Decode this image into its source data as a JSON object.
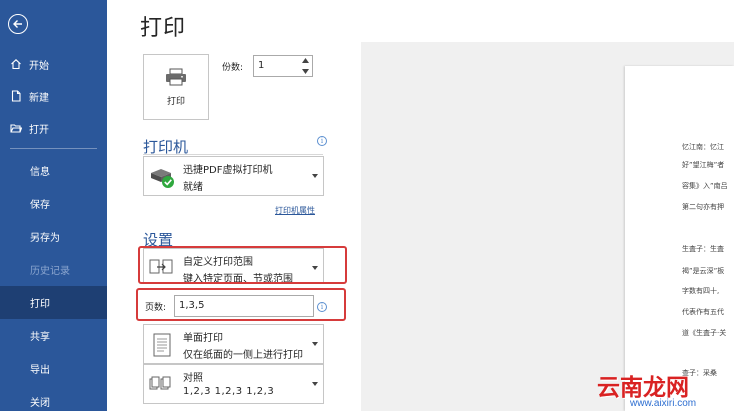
{
  "sidebar": {
    "top_items": [
      {
        "label": "开始",
        "icon": "home-icon"
      },
      {
        "label": "新建",
        "icon": "new-document-icon"
      },
      {
        "label": "打开",
        "icon": "folder-open-icon"
      }
    ],
    "bottom_items": [
      {
        "label": "信息"
      },
      {
        "label": "保存"
      },
      {
        "label": "另存为"
      },
      {
        "label": "历史记录",
        "disabled": true
      },
      {
        "label": "打印",
        "active": true
      },
      {
        "label": "共享"
      },
      {
        "label": "导出"
      },
      {
        "label": "关闭"
      }
    ]
  },
  "main": {
    "title": "打印",
    "print_button_label": "打印",
    "copies_label": "份数:",
    "copies_value": "1",
    "printer_section": "打印机",
    "printer_name": "迅捷PDF虚拟打印机",
    "printer_status": "就绪",
    "printer_properties": "打印机属性",
    "settings_section": "设置",
    "range_title": "自定义打印范围",
    "range_subtitle": "键入特定页面、节或范围",
    "pages_label": "页数:",
    "pages_value": "1,3,5",
    "sided_title": "单面打印",
    "sided_subtitle": "仅在纸面的一侧上进行打印",
    "collate_title": "对照",
    "collate_subtitle": "1,2,3    1,2,3    1,2,3",
    "info_glyph": "i"
  },
  "preview": {
    "lines": [
      "忆江南：忆江",
      "好”望江梅”者",
      "容集》入”南吕",
      "第二句亦有押",
      "生査子：生査",
      "褐”是云深”板",
      "字数有四十,",
      "代表作有五代",
      "道《生査子·关",
      "查子：采桑"
    ]
  },
  "watermark": {
    "text": "云南龙网",
    "url": "www.aixiri.com"
  },
  "colors": {
    "sidebar_bg": "#2b579a",
    "sidebar_active": "#1e3f73",
    "accent": "#2b579a",
    "highlight_box": "#d63b3b",
    "check_green": "#2fa83e"
  }
}
